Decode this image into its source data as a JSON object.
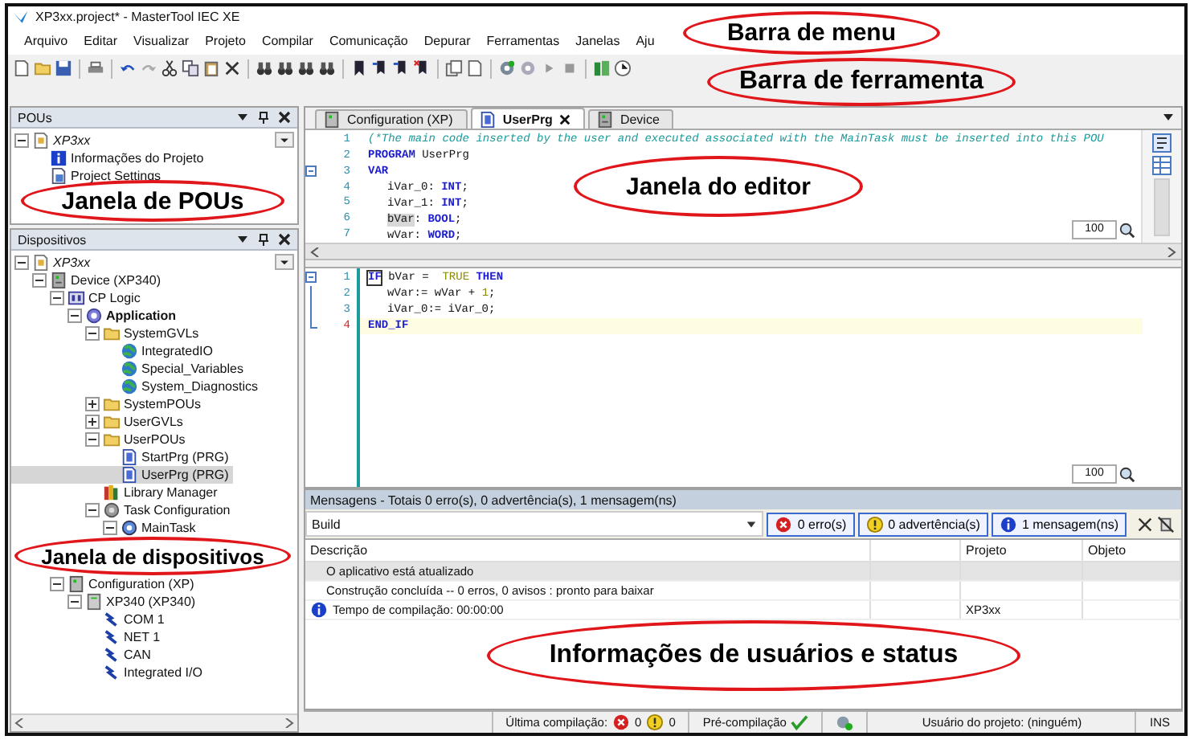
{
  "window": {
    "title": "XP3xx.project* - MasterTool IEC XE"
  },
  "menu": [
    "Arquivo",
    "Editar",
    "Visualizar",
    "Projeto",
    "Compilar",
    "Comunicação",
    "Depurar",
    "Ferramentas",
    "Janelas",
    "Aju"
  ],
  "annotations": [
    {
      "text": "Barra de menu"
    },
    {
      "text": "Barra de ferramenta"
    },
    {
      "text": "Janela de POUs"
    },
    {
      "text": "Janela do editor"
    },
    {
      "text": "Informações de usuários e status"
    }
  ],
  "pous": {
    "title": "POUs",
    "tree": [
      {
        "label": "XP3xx",
        "kind": "project",
        "expanded": true,
        "selected": false,
        "children": [
          {
            "label": "Informações do Projeto",
            "kind": "info",
            "selected": false
          },
          {
            "label": "Project Settings",
            "kind": "settings",
            "selected": false
          }
        ]
      }
    ]
  },
  "devices": {
    "title": "Dispositivos",
    "tree": [
      {
        "label": "XP3xx",
        "kind": "project",
        "expanded": true,
        "selected": false,
        "children": [
          {
            "label": "Device (XP340)",
            "kind": "device",
            "expanded": true,
            "selected": false,
            "children": [
              {
                "label": "CP Logic",
                "kind": "cpu",
                "expanded": true,
                "selected": false,
                "children": [
                  {
                    "label": "Application",
                    "kind": "application",
                    "expanded": true,
                    "selected": false,
                    "children": [
                      {
                        "label": "SystemGVLs",
                        "kind": "folder",
                        "expanded": true,
                        "selected": false,
                        "children": [
                          {
                            "label": "IntegratedIO",
                            "kind": "gvl",
                            "selected": false
                          },
                          {
                            "label": "Special_Variables",
                            "kind": "gvl",
                            "selected": false
                          },
                          {
                            "label": "System_Diagnostics",
                            "kind": "gvl",
                            "selected": false
                          }
                        ]
                      },
                      {
                        "label": "SystemPOUs",
                        "kind": "folder",
                        "expanded": false,
                        "selected": false
                      },
                      {
                        "label": "UserGVLs",
                        "kind": "folder",
                        "expanded": false,
                        "selected": false
                      },
                      {
                        "label": "UserPOUs",
                        "kind": "folder",
                        "expanded": true,
                        "selected": false,
                        "children": [
                          {
                            "label": "StartPrg (PRG)",
                            "kind": "pou",
                            "selected": false
                          },
                          {
                            "label": "UserPrg (PRG)",
                            "kind": "pou",
                            "selected": true
                          }
                        ]
                      },
                      {
                        "label": "Library Manager",
                        "kind": "library",
                        "selected": false
                      },
                      {
                        "label": "Task Configuration",
                        "kind": "taskconfig",
                        "expanded": true,
                        "selected": false,
                        "children": [
                          {
                            "label": "MainTask",
                            "kind": "task",
                            "expanded": true,
                            "selected": false,
                            "annotation": "Janela de dispositivos"
                          }
                        ]
                      }
                    ]
                  }
                ]
              },
              {
                "label": "Configuration (XP)",
                "kind": "config",
                "expanded": true,
                "selected": false,
                "children": [
                  {
                    "label": "XP340 (XP340)",
                    "kind": "module",
                    "expanded": true,
                    "selected": false,
                    "children": [
                      {
                        "label": "COM 1",
                        "kind": "port",
                        "selected": false
                      },
                      {
                        "label": "NET 1",
                        "kind": "port",
                        "selected": false
                      },
                      {
                        "label": "CAN",
                        "kind": "port",
                        "selected": false
                      },
                      {
                        "label": "Integrated I/O",
                        "kind": "port",
                        "selected": false
                      }
                    ]
                  }
                ]
              }
            ]
          }
        ]
      }
    ]
  },
  "editor": {
    "tabs": [
      {
        "label": "Configuration (XP)",
        "kind": "config",
        "selected": false,
        "closable": false
      },
      {
        "label": "UserPrg",
        "kind": "pou",
        "selected": true,
        "closable": true
      },
      {
        "label": "Device",
        "kind": "device",
        "selected": false,
        "closable": false
      }
    ],
    "declarations": {
      "zoom": "100",
      "lines": [
        {
          "number": "1",
          "kind": "line",
          "indented": false,
          "current": false,
          "tokens": [
            {
              "kind": "comment",
              "text": "(*The main code inserted by the user and executed associated with the MainTask must be inserted into this POU"
            }
          ]
        },
        {
          "number": "2",
          "kind": "line",
          "indented": false,
          "current": false,
          "tokens": [
            {
              "kind": "keyword",
              "text": "PROGRAM"
            },
            {
              "kind": "plain",
              "text": " UserPrg"
            }
          ]
        },
        {
          "number": "3",
          "kind": "fold_start",
          "indented": false,
          "current": false,
          "tokens": [
            {
              "kind": "keyword",
              "text": "VAR"
            }
          ]
        },
        {
          "number": "4",
          "kind": "line",
          "indented": true,
          "current": false,
          "tokens": [
            {
              "kind": "plain",
              "text": "iVar_0: "
            },
            {
              "kind": "keyword",
              "text": "INT"
            },
            {
              "kind": "plain",
              "text": ";"
            }
          ]
        },
        {
          "number": "5",
          "kind": "line",
          "indented": true,
          "current": false,
          "tokens": [
            {
              "kind": "plain",
              "text": "iVar_1: "
            },
            {
              "kind": "keyword",
              "text": "INT"
            },
            {
              "kind": "plain",
              "text": ";"
            }
          ]
        },
        {
          "number": "6",
          "kind": "line",
          "indented": true,
          "current": false,
          "tokens": [
            {
              "kind": "highlight",
              "text": "bVar"
            },
            {
              "kind": "plain",
              "text": ": "
            },
            {
              "kind": "keyword",
              "text": "BOOL"
            },
            {
              "kind": "plain",
              "text": ";"
            }
          ]
        },
        {
          "number": "7",
          "kind": "line",
          "indented": true,
          "current": false,
          "tokens": [
            {
              "kind": "plain",
              "text": "wVar: "
            },
            {
              "kind": "keyword",
              "text": "WORD"
            },
            {
              "kind": "plain",
              "text": ";"
            }
          ]
        }
      ]
    },
    "body": {
      "zoom": "100",
      "lines": [
        {
          "number": "1",
          "kind": "fold_start",
          "indented": false,
          "current": false,
          "tokens": [
            {
              "kind": "match",
              "text": "IF"
            },
            {
              "kind": "plain",
              "text": " bVar =  "
            },
            {
              "kind": "literal",
              "text": "TRUE"
            },
            {
              "kind": "keyword",
              "text": " THEN"
            }
          ]
        },
        {
          "number": "2",
          "kind": "fold_mid",
          "indented": true,
          "current": false,
          "tokens": [
            {
              "kind": "plain",
              "text": "wVar:= wVar + "
            },
            {
              "kind": "literal",
              "text": "1"
            },
            {
              "kind": "plain",
              "text": ";"
            }
          ]
        },
        {
          "number": "3",
          "kind": "fold_mid",
          "indented": true,
          "current": false,
          "tokens": [
            {
              "kind": "plain",
              "text": "iVar_0:= iVar_0;"
            }
          ]
        },
        {
          "number": "4",
          "kind": "fold_end",
          "indented": false,
          "current": true,
          "tokens": [
            {
              "kind": "keyword",
              "text": "END_IF"
            }
          ]
        }
      ]
    }
  },
  "messages": {
    "title": "Mensagens - Totais 0 erro(s), 0 advertência(s), 1 mensagem(ns)",
    "source": "Build",
    "filters": [
      {
        "kind": "error",
        "label": "0 erro(s)",
        "selected": true
      },
      {
        "kind": "warning",
        "label": "0 advertência(s)",
        "selected": true
      },
      {
        "kind": "info",
        "label": "1 mensagem(ns)",
        "selected": true
      }
    ],
    "columns": [
      "Descrição",
      "Projeto",
      "Objeto"
    ],
    "rows": [
      {
        "kind": "none",
        "description": "O aplicativo está atualizado",
        "selected": true
      },
      {
        "kind": "none",
        "description": "Construção concluída -- 0 erros, 0 avisos : pronto para baixar",
        "selected": false
      },
      {
        "kind": "info",
        "description": "Tempo de compilação: 00:00:00",
        "project": "XP3xx",
        "selected": false
      }
    ]
  },
  "status_bar": {
    "last_build_label": "Última compilação:",
    "errors": "0",
    "warnings": "0",
    "precompile_label": "Pré-compilação",
    "precompile_ok": true,
    "user": "Usuário do projeto: (ninguém)",
    "mode": "INS"
  }
}
